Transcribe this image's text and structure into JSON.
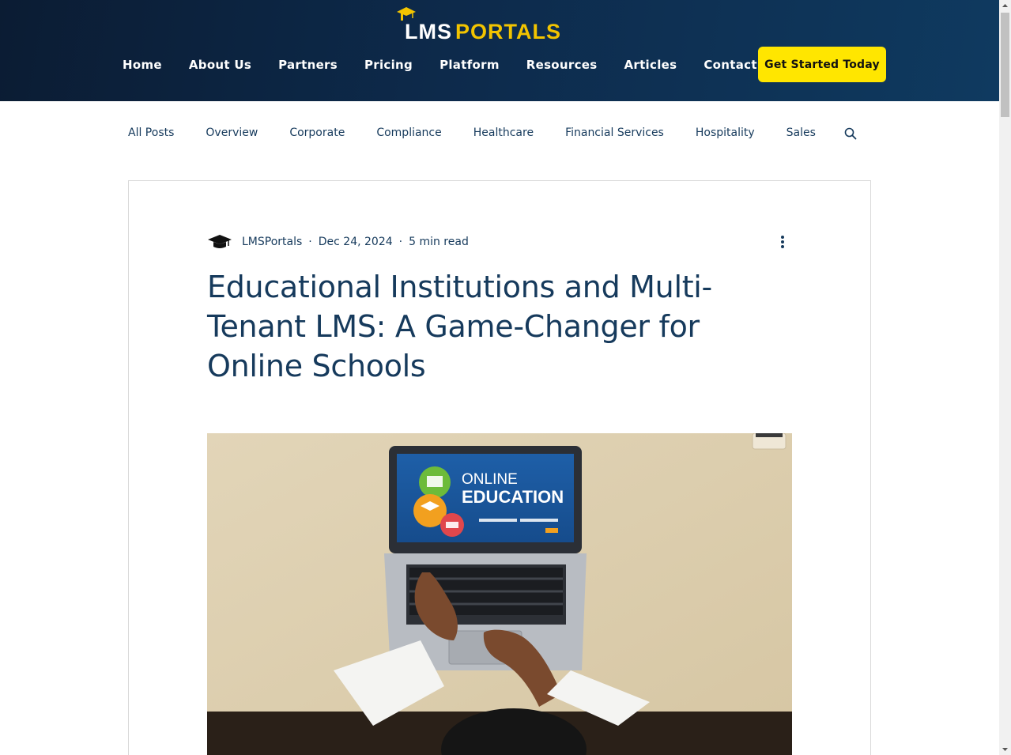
{
  "header": {
    "logo": {
      "part1": "LMS",
      "part2": "PORTALS"
    },
    "nav": [
      {
        "label": "Home"
      },
      {
        "label": "About Us"
      },
      {
        "label": "Partners"
      },
      {
        "label": "Pricing"
      },
      {
        "label": "Platform"
      },
      {
        "label": "Resources"
      },
      {
        "label": "Articles"
      },
      {
        "label": "Contact Us"
      }
    ],
    "cta_label": "Get Started Today"
  },
  "categories": [
    {
      "label": "All Posts"
    },
    {
      "label": "Overview"
    },
    {
      "label": "Corporate"
    },
    {
      "label": "Compliance"
    },
    {
      "label": "Healthcare"
    },
    {
      "label": "Financial Services"
    },
    {
      "label": "Hospitality"
    },
    {
      "label": "Sales"
    }
  ],
  "post": {
    "author": "LMSPortals",
    "separator": "·",
    "date": "Dec 24, 2024",
    "read_time": "5 min read",
    "title": "Educational Institutions and Multi-Tenant LMS: A Game-Changer for Online Schools",
    "image": {
      "screen_title_line1": "ONLINE",
      "screen_title_line2": "EDUCATION"
    }
  },
  "colors": {
    "header_bg": "#0d2a4b",
    "accent_yellow": "#ffe600",
    "logo_yellow": "#f2c400",
    "text_navy": "#163a5c",
    "card_border": "#d9d9d9"
  },
  "icons": {
    "logo": "graduation-cap-icon",
    "search": "search-icon",
    "avatar": "graduation-cap-icon",
    "more": "more-vertical-icon"
  }
}
